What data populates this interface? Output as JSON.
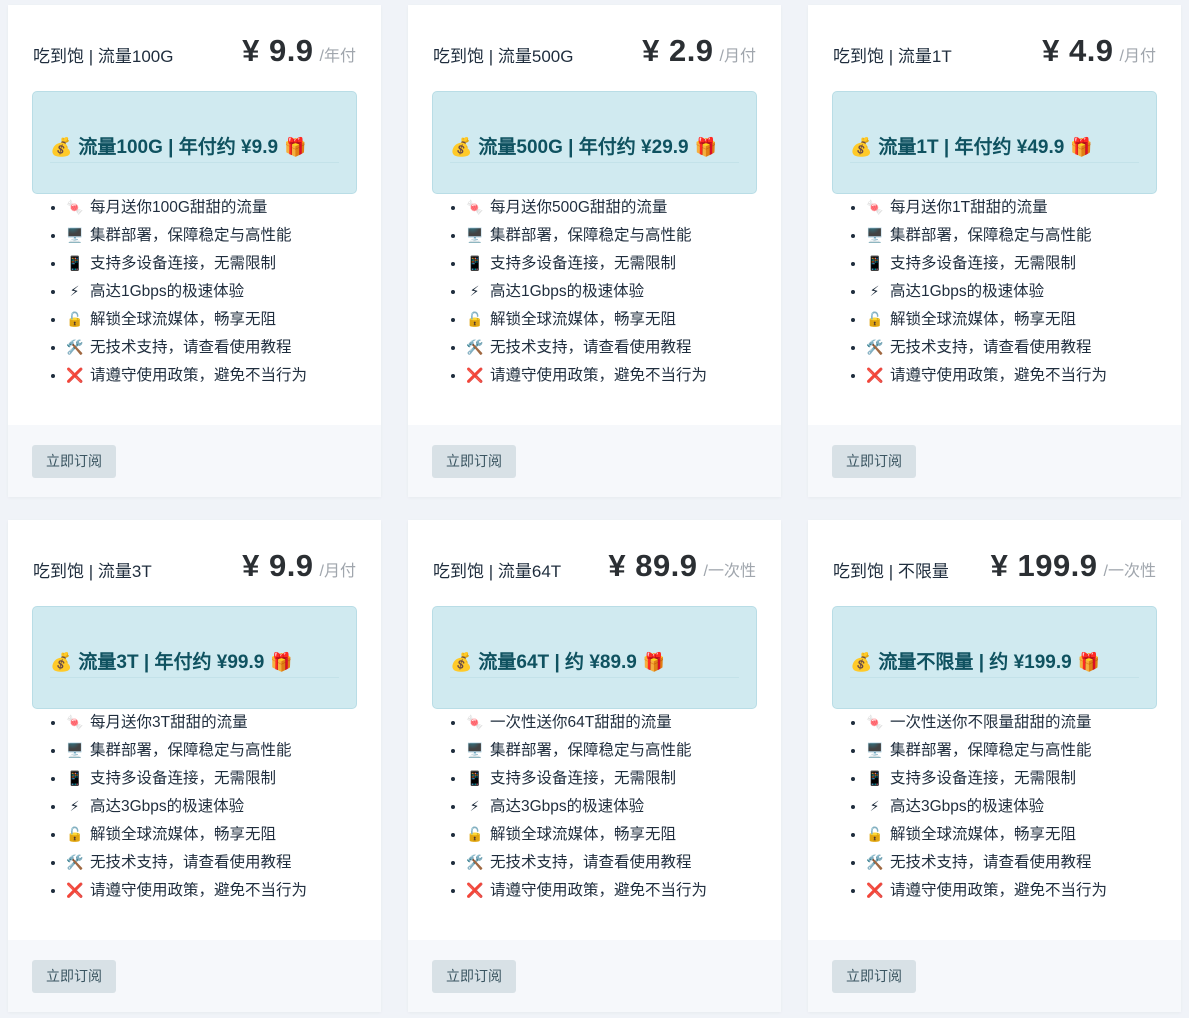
{
  "cards": [
    {
      "name": "吃到饱 | 流量100G",
      "price": "¥ 9.9",
      "period": "/年付",
      "promo": "流量100G | 年付约 ¥9.9",
      "features": [
        "每月送你100G甜甜的流量",
        "集群部署，保障稳定与高性能",
        "支持多设备连接，无需限制",
        "高达1Gbps的极速体验",
        "解锁全球流媒体，畅享无阻",
        "无技术支持，请查看使用教程",
        "请遵守使用政策，避免不当行为"
      ],
      "button": "立即订阅"
    },
    {
      "name": "吃到饱 | 流量500G",
      "price": "¥ 2.9",
      "period": "/月付",
      "promo": "流量500G | 年付约 ¥29.9",
      "features": [
        "每月送你500G甜甜的流量",
        "集群部署，保障稳定与高性能",
        "支持多设备连接，无需限制",
        "高达1Gbps的极速体验",
        "解锁全球流媒体，畅享无阻",
        "无技术支持，请查看使用教程",
        "请遵守使用政策，避免不当行为"
      ],
      "button": "立即订阅"
    },
    {
      "name": "吃到饱 | 流量1T",
      "price": "¥ 4.9",
      "period": "/月付",
      "promo": "流量1T | 年付约 ¥49.9",
      "features": [
        "每月送你1T甜甜的流量",
        "集群部署，保障稳定与高性能",
        "支持多设备连接，无需限制",
        "高达1Gbps的极速体验",
        "解锁全球流媒体，畅享无阻",
        "无技术支持，请查看使用教程",
        "请遵守使用政策，避免不当行为"
      ],
      "button": "立即订阅"
    },
    {
      "name": "吃到饱 | 流量3T",
      "price": "¥ 9.9",
      "period": "/月付",
      "promo": "流量3T | 年付约 ¥99.9",
      "features": [
        "每月送你3T甜甜的流量",
        "集群部署，保障稳定与高性能",
        "支持多设备连接，无需限制",
        "高达3Gbps的极速体验",
        "解锁全球流媒体，畅享无阻",
        "无技术支持，请查看使用教程",
        "请遵守使用政策，避免不当行为"
      ],
      "button": "立即订阅"
    },
    {
      "name": "吃到饱 | 流量64T",
      "price": "¥ 89.9",
      "period": "/一次性",
      "promo": "流量64T | 约 ¥89.9",
      "features": [
        "一次性送你64T甜甜的流量",
        "集群部署，保障稳定与高性能",
        "支持多设备连接，无需限制",
        "高达3Gbps的极速体验",
        "解锁全球流媒体，畅享无阻",
        "无技术支持，请查看使用教程",
        "请遵守使用政策，避免不当行为"
      ],
      "button": "立即订阅"
    },
    {
      "name": "吃到饱 | 不限量",
      "price": "¥ 199.9",
      "period": "/一次性",
      "promo": "流量不限量 | 约 ¥199.9",
      "features": [
        "一次性送你不限量甜甜的流量",
        "集群部署，保障稳定与高性能",
        "支持多设备连接，无需限制",
        "高达3Gbps的极速体验",
        "解锁全球流媒体，畅享无阻",
        "无技术支持，请查看使用教程",
        "请遵守使用政策，避免不当行为"
      ],
      "button": "立即订阅"
    }
  ],
  "icons": {
    "promo_left": "💰",
    "promo_right": "🎁",
    "features": [
      "🍬",
      "🖥️",
      "📱",
      "⚡",
      "🔓",
      "🛠️",
      "❌"
    ],
    "feature_names": [
      "candy-icon",
      "computer-icon",
      "mobile-phone-icon",
      "lightning-icon",
      "unlock-icon",
      "tools-icon",
      "cross-mark-icon"
    ]
  }
}
